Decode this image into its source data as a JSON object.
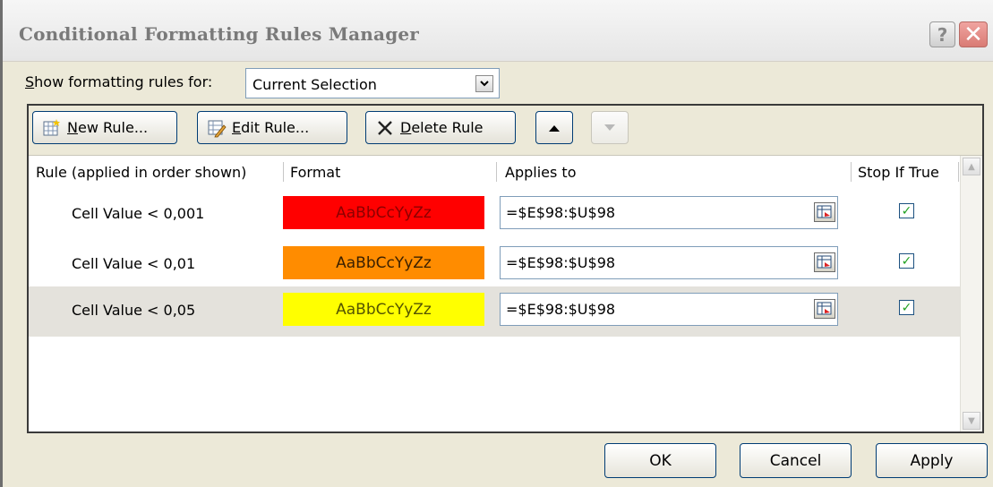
{
  "window": {
    "title": "Conditional Formatting Rules Manager",
    "help_label": "?",
    "close_label": "✕"
  },
  "show_rules": {
    "label": "Show formatting rules for:",
    "selected": "Current Selection"
  },
  "toolbar": {
    "new_rule": "New Rule...",
    "edit_rule": "Edit Rule...",
    "delete_rule": "Delete Rule"
  },
  "columns": {
    "rule": "Rule (applied in order shown)",
    "format": "Format",
    "applies_to": "Applies to",
    "stop_if_true": "Stop If True"
  },
  "rules": [
    {
      "rule": "Cell Value < 0,001",
      "preview": "AaBbCcYyZz",
      "bg": "#ff0000",
      "fg": "#8b0000",
      "applies_to": "=$E$98:$U$98",
      "stop_if_true": true
    },
    {
      "rule": "Cell Value < 0,01",
      "preview": "AaBbCcYyZz",
      "bg": "#ff8c00",
      "fg": "#3a2000",
      "applies_to": "=$E$98:$U$98",
      "stop_if_true": true
    },
    {
      "rule": "Cell Value < 0,05",
      "preview": "AaBbCcYyZz",
      "bg": "#ffff00",
      "fg": "#555500",
      "applies_to": "=$E$98:$U$98",
      "stop_if_true": true
    }
  ],
  "buttons": {
    "ok": "OK",
    "cancel": "Cancel",
    "apply": "Apply"
  }
}
